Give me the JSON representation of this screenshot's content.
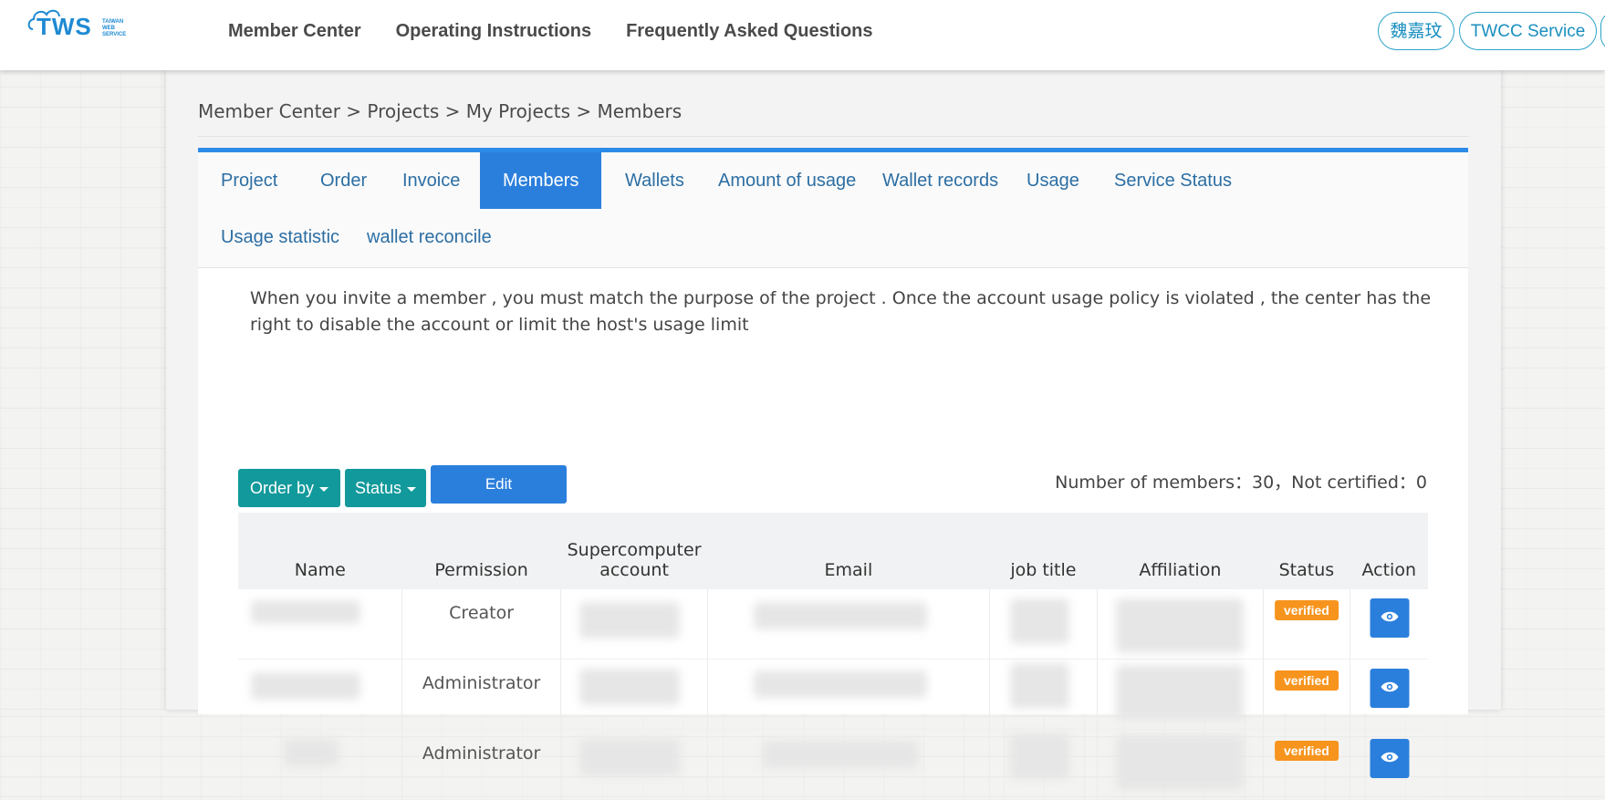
{
  "header": {
    "logo_text": "TWS",
    "logo_sub": [
      "TAIWAN",
      "WEB",
      "SERVICE"
    ],
    "nav": [
      "Member Center",
      "Operating Instructions",
      "Frequently Asked Questions"
    ],
    "user_button": "魏嘉玟",
    "service_button": "TWCC Service"
  },
  "breadcrumb": "Member Center > Projects > My Projects > Members",
  "tabs": [
    "Project",
    "Order",
    "Invoice",
    "Members",
    "Wallets",
    "Amount of usage",
    "Wallet records",
    "Usage",
    "Service Status",
    "Usage statistic",
    "wallet reconcile"
  ],
  "active_tab": "Members",
  "notice": "When you invite a member , you must match the purpose of the project . Once the account usage policy is violated , the center has the right to disable the account or limit the host's usage limit",
  "toolbar": {
    "order_by": "Order by",
    "status": "Status",
    "edit": "Edit",
    "member_count": "Number of members：30，Not certified：0"
  },
  "table": {
    "headers": [
      "Name",
      "Permission",
      "Supercomputer account",
      "Email",
      "job title",
      "Affiliation",
      "Status",
      "Action"
    ],
    "rows": [
      {
        "permission": "Creator",
        "status": "verified"
      },
      {
        "permission": "Administrator",
        "status": "verified"
      },
      {
        "permission": "Administrator",
        "status": "verified"
      }
    ]
  },
  "colors": {
    "accent": "#2b7fdc",
    "teal": "#12999b",
    "badge": "#f7941d"
  }
}
